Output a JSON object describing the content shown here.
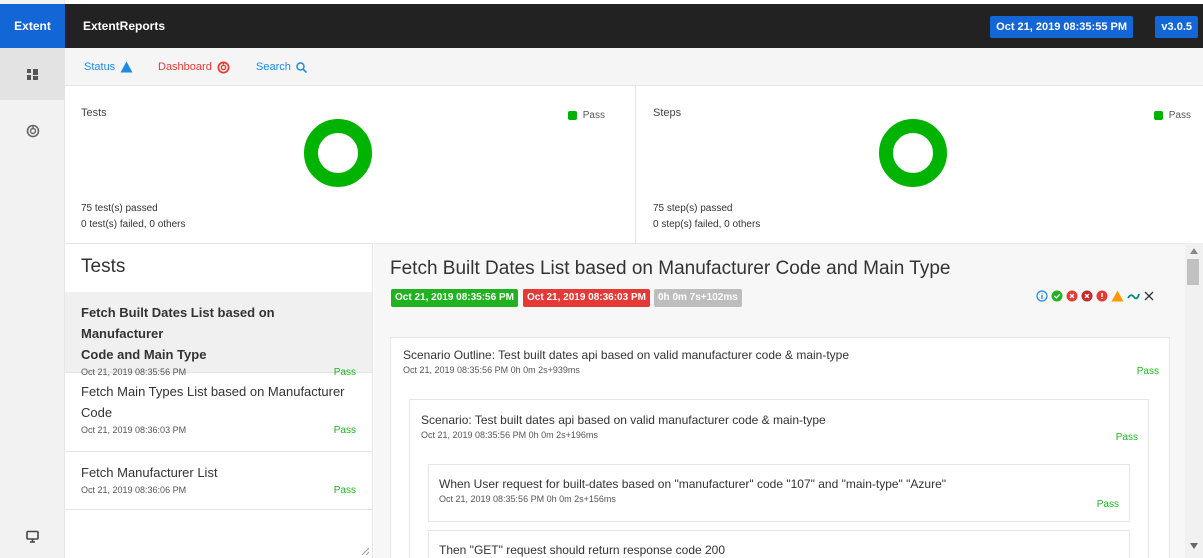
{
  "app": {
    "brand": "Extent",
    "title": "ExtentReports",
    "date_badge": "Oct 21, 2019 08:35:55 PM",
    "version": "v3.0.5"
  },
  "subnav": {
    "status": "Status",
    "dashboard": "Dashboard",
    "search": "Search"
  },
  "colors": {
    "accent": "#1366d6",
    "pass": "#00b300",
    "fail": "#e53935",
    "topbar": "#222222"
  },
  "cards": {
    "tests": {
      "title": "Tests",
      "legend": "Pass",
      "passed": "75 test(s) passed",
      "failed": "0 test(s) failed, 0 others",
      "pass_fraction": 1.0
    },
    "steps": {
      "title": "Steps",
      "legend": "Pass",
      "passed": "75 step(s) passed",
      "failed": "0 step(s) failed, 0 others",
      "pass_fraction": 1.0
    }
  },
  "tests_panel": {
    "heading": "Tests",
    "items": [
      {
        "name_lines": [
          "Fetch Built Dates List based on Manufacturer",
          "Code and Main Type"
        ],
        "time": "Oct 21, 2019 08:35:56 PM",
        "status": "Pass"
      },
      {
        "name_lines": [
          "Fetch Main Types List based on Manufacturer",
          "Code"
        ],
        "time": "Oct 21, 2019 08:36:03 PM",
        "status": "Pass"
      },
      {
        "name_lines": [
          "Fetch Manufacturer List"
        ],
        "time": "Oct 21, 2019 08:36:06 PM",
        "status": "Pass"
      }
    ]
  },
  "detail": {
    "title": "Fetch Built Dates List based on Manufacturer Code and Main Type",
    "start": "Oct 21, 2019 08:35:56 PM",
    "end": "Oct 21, 2019 08:36:03 PM",
    "duration": "0h 0m 7s+102ms",
    "status_icons": [
      "info-icon",
      "pass-icon",
      "fail-icon",
      "fatal-icon",
      "error-icon",
      "warning-icon",
      "skip-icon",
      "close-icon"
    ],
    "outline": {
      "text": "Scenario Outline: Test built dates api based on valid manufacturer code & main-type",
      "meta": "Oct 21, 2019 08:35:56 PM 0h 0m 2s+939ms",
      "status": "Pass"
    },
    "scenario": {
      "text": "Scenario: Test built dates api based on valid manufacturer code & main-type",
      "meta": "Oct 21, 2019 08:35:56 PM 0h 0m 2s+196ms",
      "status": "Pass"
    },
    "step1": {
      "text": "When User request for built-dates based on \"manufacturer\" code \"107\" and \"main-type\" \"Azure\"",
      "meta": "Oct 21, 2019 08:35:56 PM 0h 0m 2s+156ms",
      "status": "Pass"
    },
    "step2": {
      "text": "Then \"GET\" request should return response code 200"
    }
  }
}
